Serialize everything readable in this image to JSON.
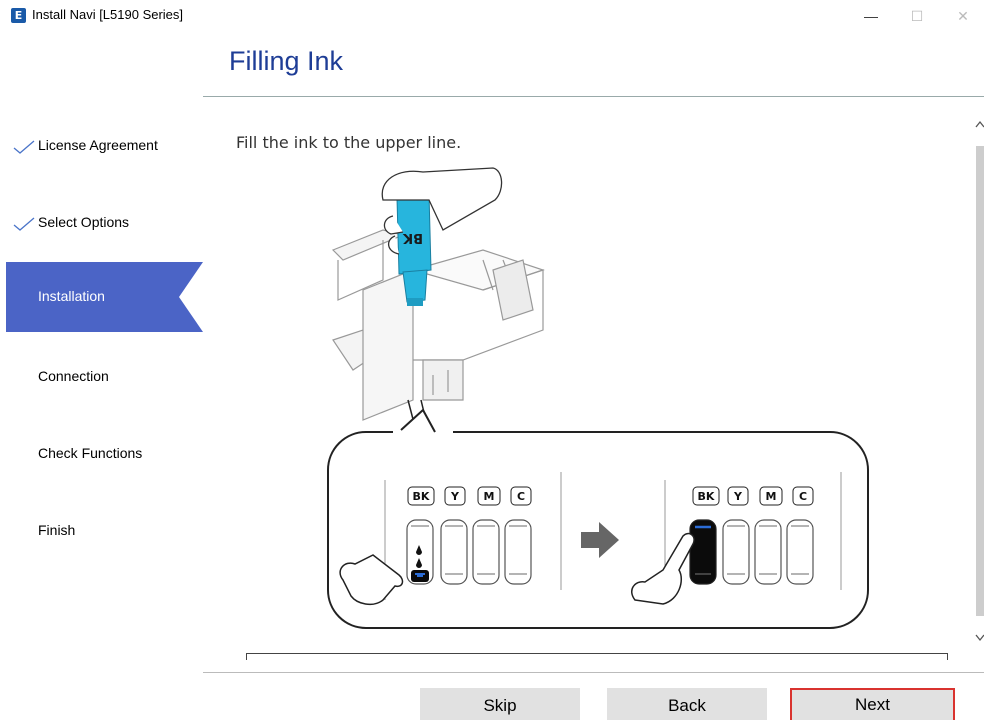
{
  "window": {
    "title": "Install Navi [L5190 Series]",
    "app_icon_letter": "E",
    "minimize_glyph": "—",
    "maximize_glyph": "☐",
    "close_glyph": "✕"
  },
  "page_title": "Filling Ink",
  "sidebar": {
    "accent_color": "#4b64c6",
    "steps": [
      {
        "label": "License Agreement",
        "completed": true,
        "active": false
      },
      {
        "label": "Select Options",
        "completed": true,
        "active": false
      },
      {
        "label": "Installation",
        "completed": false,
        "active": true
      },
      {
        "label": "Connection",
        "completed": false,
        "active": false
      },
      {
        "label": "Check Functions",
        "completed": false,
        "active": false
      },
      {
        "label": "Finish",
        "completed": false,
        "active": false
      }
    ]
  },
  "main": {
    "instruction": "Fill the ink to the upper line.",
    "tank_labels": [
      "BK",
      "Y",
      "M",
      "C"
    ],
    "bottle_label": "BK"
  },
  "buttons": {
    "skip": "Skip",
    "back": "Back",
    "next": "Next"
  }
}
